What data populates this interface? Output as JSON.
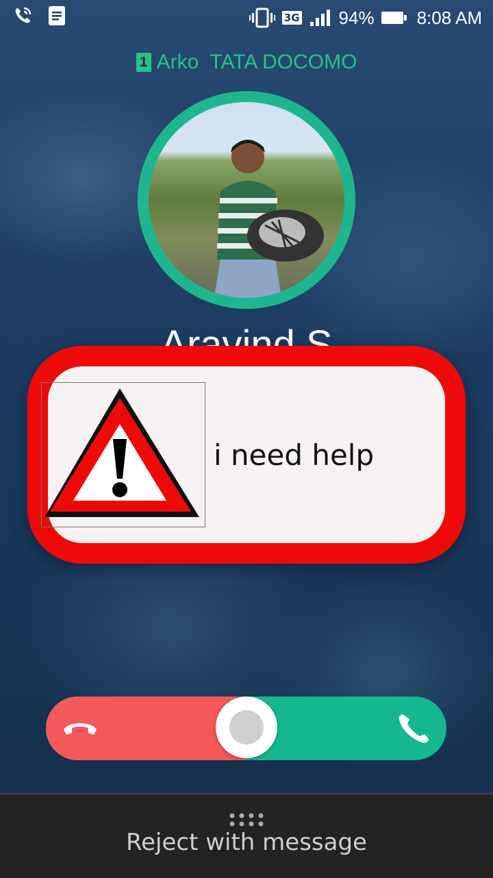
{
  "status_bar": {
    "network_type": "3G",
    "battery_percent": "94%",
    "time": "8:08 AM",
    "icons": [
      "wifi-calling-icon",
      "notes-icon",
      "vibrate-icon",
      "signal-icon",
      "battery-icon"
    ]
  },
  "carrier": {
    "sim_slot": "1",
    "name": "Arko  TATA DOCOMO",
    "color": "#25c38a"
  },
  "caller": {
    "name": "Aravind S",
    "avatar_ring_color": "#1fb68f"
  },
  "alert": {
    "message": "i need help",
    "icon": "warning-triangle-icon",
    "frame_color": "#ef0a0a"
  },
  "call_slider": {
    "reject_color": "#f2595a",
    "accept_color": "#16b890",
    "reject_icon": "hang-up-icon",
    "accept_icon": "phone-icon"
  },
  "bottom": {
    "reject_with_message": "Reject with message"
  }
}
